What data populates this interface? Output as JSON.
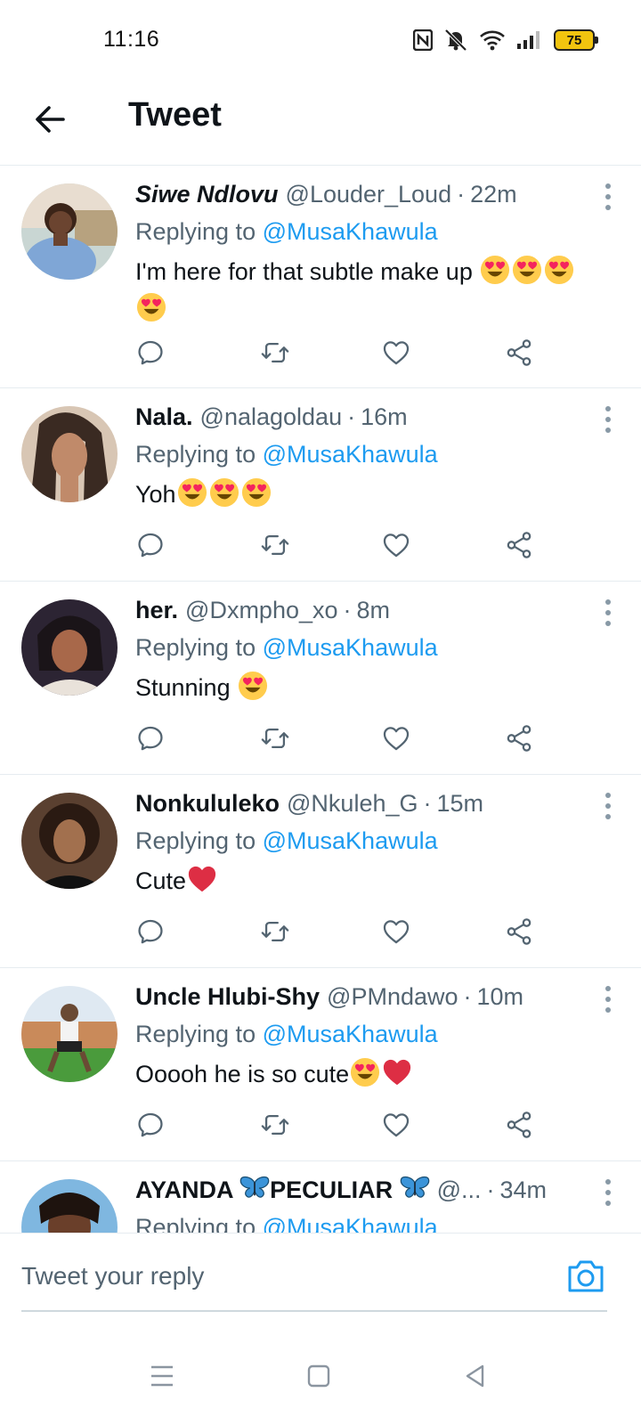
{
  "status_bar": {
    "time": "11:16",
    "battery": "75"
  },
  "header": {
    "title": "Tweet"
  },
  "tweets": [
    {
      "name": "Siwe Ndlovu",
      "handle": "@Louder_Loud",
      "dot": "·",
      "time": "22m",
      "replying_prefix": "Replying to",
      "replying_to": "@MusaKhawula",
      "text": "I'm here for that subtle make up"
    },
    {
      "name": "Nala.",
      "handle": "@nalagoldau",
      "dot": "·",
      "time": "16m",
      "replying_prefix": "Replying to",
      "replying_to": "@MusaKhawula",
      "text": "Yoh"
    },
    {
      "name": "her.",
      "handle": "@Dxmpho_xo",
      "dot": "·",
      "time": "8m",
      "replying_prefix": "Replying to",
      "replying_to": "@MusaKhawula",
      "text": "Stunning "
    },
    {
      "name": "Nonkululeko",
      "handle": "@Nkuleh_G",
      "dot": "·",
      "time": "15m",
      "replying_prefix": "Replying to",
      "replying_to": "@MusaKhawula",
      "text": "Cute"
    },
    {
      "name": "Uncle Hlubi-Shy",
      "handle": "@PMndawo",
      "dot": "·",
      "time": "10m",
      "replying_prefix": "Replying to",
      "replying_to": "@MusaKhawula",
      "text": "Ooooh he is so cute"
    },
    {
      "name_part1": "AYANDA",
      "name_part2": "PECULIAR",
      "handle": "@...",
      "dot": "·",
      "time": "34m",
      "replying_prefix": "Replying to",
      "replying_to": "@MusaKhawula"
    }
  ],
  "reply_bar": {
    "placeholder": "Tweet your reply"
  },
  "icons": {
    "back": "arrow-left-icon",
    "nfc": "nfc-icon",
    "mute": "bell-off-icon",
    "wifi": "wifi-icon",
    "signal": "signal-icon",
    "reply": "reply-icon",
    "retweet": "retweet-icon",
    "like": "heart-icon",
    "share": "share-icon",
    "more": "more-vertical-icon",
    "camera": "camera-icon",
    "menu": "menu-icon",
    "home": "home-square-icon",
    "back_nav": "back-triangle-icon"
  },
  "colors": {
    "accent": "#1d9bf0",
    "secondary_text": "#536471",
    "divider": "#e6ecf0",
    "heart": "#e0245e"
  }
}
